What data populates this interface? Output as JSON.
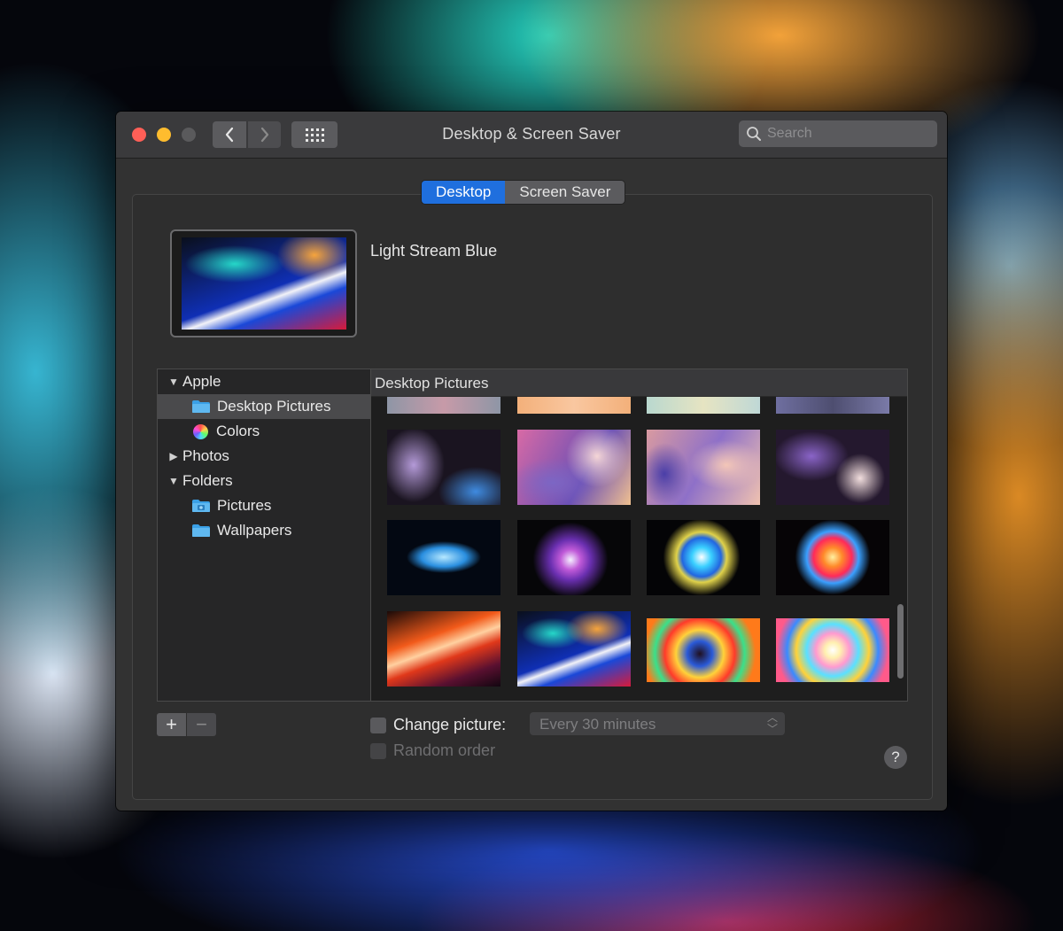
{
  "window": {
    "title": "Desktop & Screen Saver"
  },
  "search": {
    "placeholder": "Search"
  },
  "tabs": [
    {
      "label": "Desktop",
      "active": true
    },
    {
      "label": "Screen Saver",
      "active": false
    }
  ],
  "current_picture": {
    "name": "Light Stream Blue"
  },
  "sidebar": {
    "items": [
      {
        "label": "Apple",
        "kind": "group",
        "expanded": true,
        "icon": "disclosure-down-icon"
      },
      {
        "label": "Desktop Pictures",
        "kind": "folder",
        "selected": true,
        "icon": "folder-icon"
      },
      {
        "label": "Colors",
        "kind": "colors",
        "icon": "color-wheel-icon"
      },
      {
        "label": "Photos",
        "kind": "group",
        "expanded": false,
        "icon": "disclosure-right-icon"
      },
      {
        "label": "Folders",
        "kind": "group",
        "expanded": true,
        "icon": "disclosure-down-icon"
      },
      {
        "label": "Pictures",
        "kind": "folder",
        "icon": "pictures-folder-icon"
      },
      {
        "label": "Wallpapers",
        "kind": "folder",
        "icon": "folder-icon"
      }
    ]
  },
  "grid": {
    "header": "Desktop Pictures",
    "thumbnails": [
      "wallpaper-partial-1",
      "wallpaper-partial-2",
      "wallpaper-partial-3",
      "wallpaper-partial-4",
      "abstract-purple-1",
      "abstract-purple-2",
      "abstract-purple-3",
      "abstract-purple-4",
      "blue-color-burst",
      "purple-pink-powder-burst",
      "cyan-blue-powder-burst",
      "red-yellow-powder-burst",
      "orange-light-stream",
      "light-stream-blue",
      "rainbow-tunnel",
      "rainbow-streaks"
    ]
  },
  "options": {
    "change_picture_label": "Change picture:",
    "interval_value": "Every 30 minutes",
    "random_order_label": "Random order"
  },
  "buttons": {
    "add": "+",
    "remove": "−",
    "help": "?"
  },
  "colors": {
    "accent": "#1f6fde",
    "window_bg": "#323232",
    "titlebar": "#3a3a3c"
  }
}
